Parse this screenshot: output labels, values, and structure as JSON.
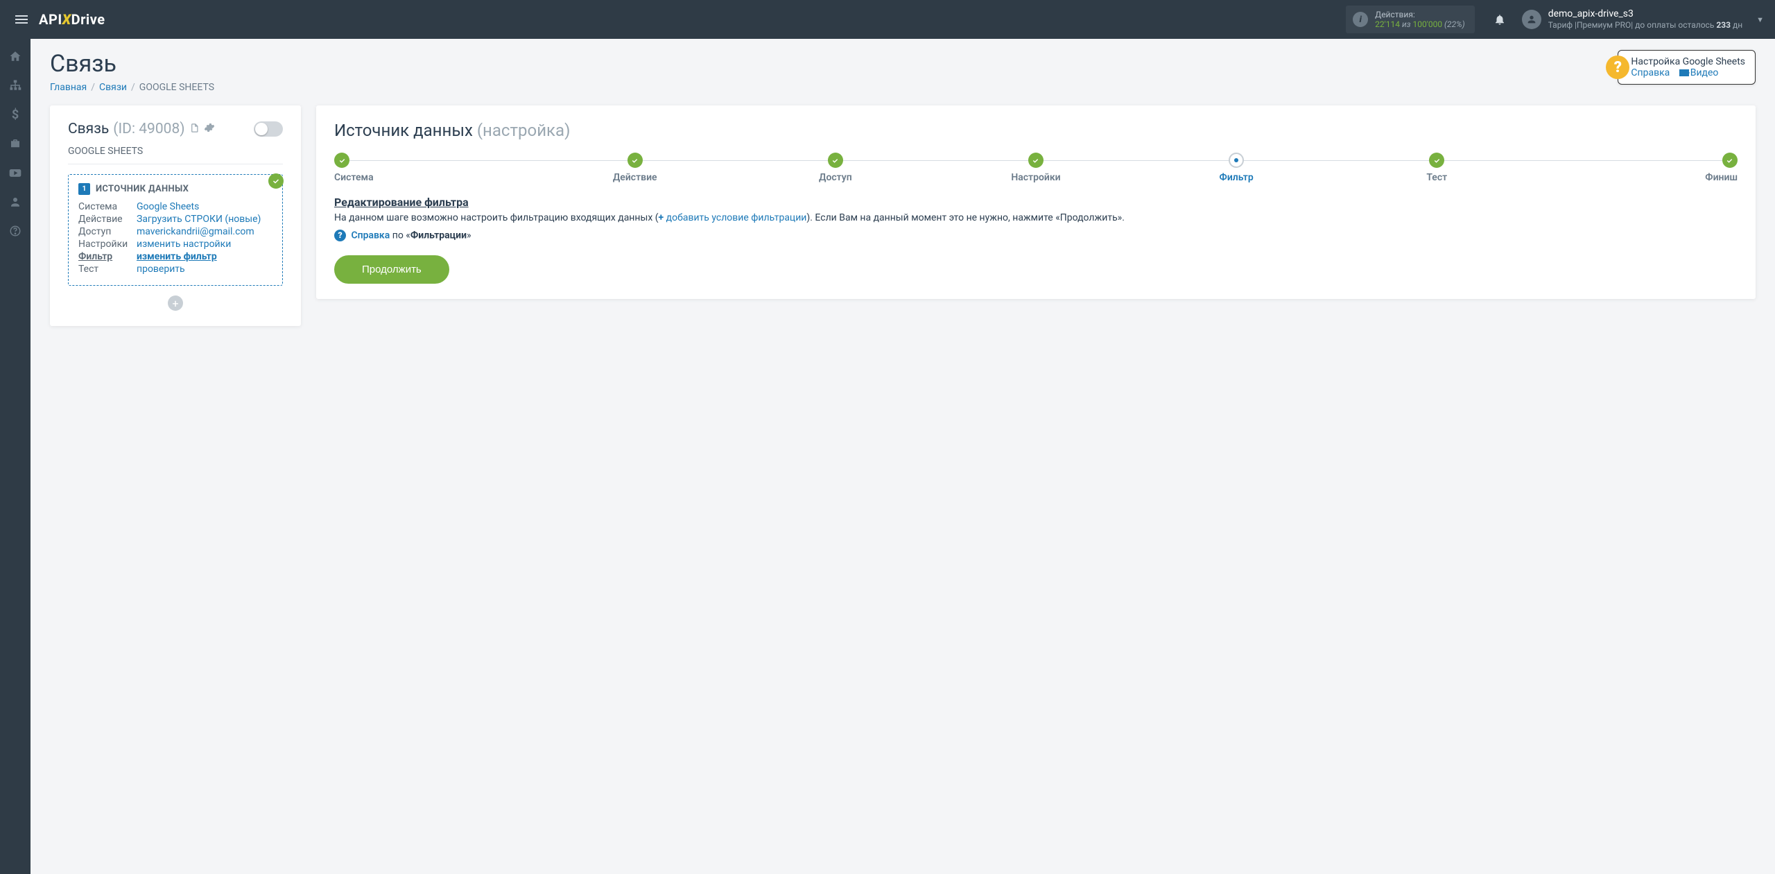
{
  "topbar": {
    "logo_pre": "API",
    "logo_post": "Drive",
    "actions_label": "Действия:",
    "actions_current": "22'114",
    "actions_of": " из ",
    "actions_total": "100'000",
    "actions_pct": " (22%)",
    "username": "demo_apix-drive_s3",
    "tariff_pre": "Тариф |Премиум PRO| до оплаты осталось ",
    "tariff_days": "233",
    "tariff_suf": " дн"
  },
  "page": {
    "title": "Связь",
    "bc_home": "Главная",
    "bc_links": "Связи",
    "bc_current": "GOOGLE SHEETS"
  },
  "help": {
    "title": "Настройка Google Sheets",
    "ref": "Справка",
    "video": "Видео"
  },
  "left": {
    "title": "Связь",
    "id": "(ID: 49008)",
    "sub": "GOOGLE SHEETS",
    "src_title": "ИСТОЧНИК ДАННЫХ",
    "rows": [
      {
        "k": "Система",
        "v": "Google Sheets"
      },
      {
        "k": "Действие",
        "v": "Загрузить СТРОКИ (новые)"
      },
      {
        "k": "Доступ",
        "v": "maverickandrii@gmail.com"
      },
      {
        "k": "Настройки",
        "v": "изменить настройки"
      },
      {
        "k": "Фильтр",
        "v": "изменить фильтр"
      },
      {
        "k": "Тест",
        "v": "проверить"
      }
    ]
  },
  "right": {
    "title": "Источник данных ",
    "title_sfx": "(настройка)",
    "steps": [
      "Система",
      "Действие",
      "Доступ",
      "Настройки",
      "Фильтр",
      "Тест",
      "Финиш"
    ],
    "current_step": 4,
    "section_h": "Редактирование фильтра",
    "desc_pre": "На данном шаге возможно настроить фильтрацию входящих данных (",
    "desc_link": "добавить условие фильтрации",
    "desc_post": "). Если Вам на данный момент это не нужно, нажмите «Продолжить».",
    "help_ref": "Справка",
    "help_mid": " по «",
    "help_bold": "Фильтрации",
    "help_end": "»",
    "continue": "Продолжить"
  }
}
